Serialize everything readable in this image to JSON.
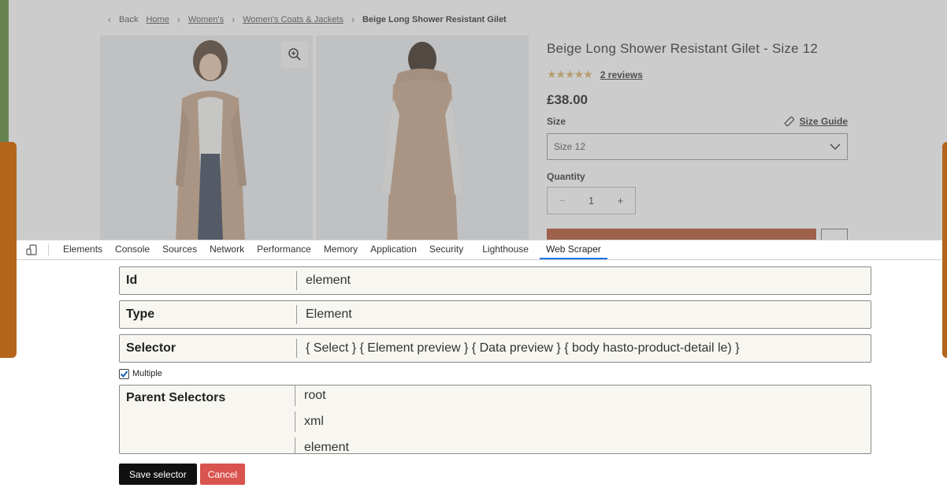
{
  "breadcrumb": {
    "back": "Back",
    "items": [
      "Home",
      "Women's",
      "Women's Coats & Jackets"
    ],
    "current": "Beige Long Shower Resistant Gilet"
  },
  "product": {
    "title": "Beige Long Shower Resistant Gilet - Size 12",
    "stars": "★★★★★",
    "reviews": "2 reviews",
    "price": "£38.00",
    "size_label": "Size",
    "size_guide": "Size Guide",
    "size_value": "Size 12",
    "quantity_label": "Quantity",
    "quantity_value": "1",
    "quantity_minus": "−",
    "quantity_plus": "+"
  },
  "devtools": {
    "tabs": [
      "Elements",
      "Console",
      "Sources",
      "Network",
      "Performance",
      "Memory",
      "Application",
      "Security",
      "Lighthouse",
      "Web Scraper"
    ],
    "active_tab": "Web Scraper"
  },
  "form": {
    "id_label": "Id",
    "id_value": "element",
    "type_label": "Type",
    "type_value": "Element",
    "selector_label": "Selector",
    "selector_value": "{ Select } { Element preview } { Data preview } { body hasto-product-detail le) }",
    "multiple_label": "Multiple",
    "multiple_checked": true,
    "parent_label": "Parent Selectors",
    "parent_options": [
      "root",
      "xml",
      "element"
    ],
    "save_button": "Save selector",
    "cancel_button": "Cancel"
  },
  "colors": {
    "left_stripe": "#5b8a36",
    "orange_panel": "#b4651c",
    "active_tab_underline": "#1a73e8",
    "cancel": "#d9534f",
    "save": "#111111"
  }
}
